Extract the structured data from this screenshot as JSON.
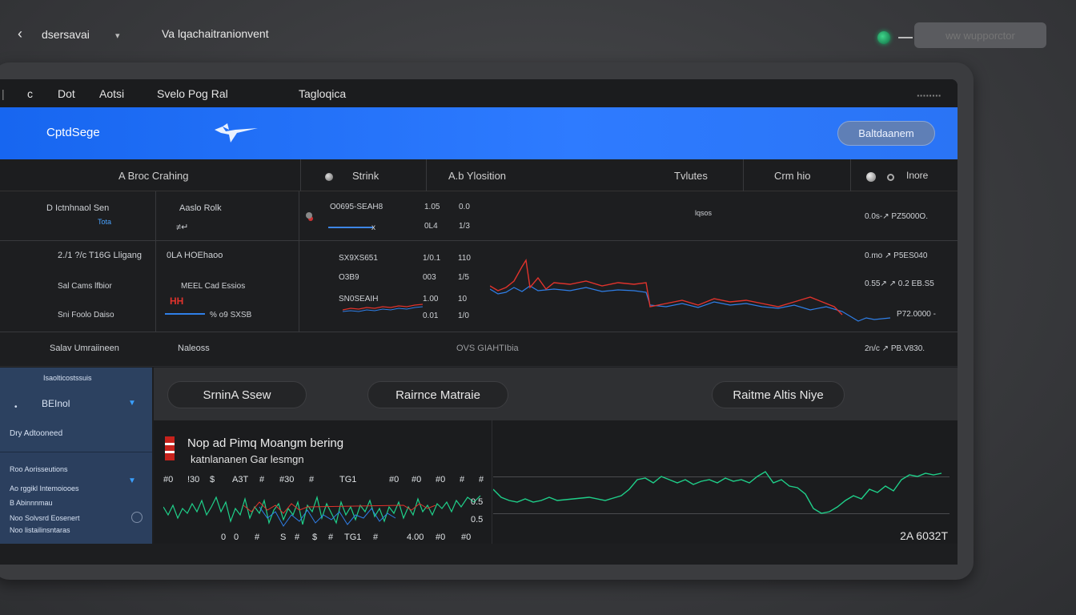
{
  "topbar": {
    "user": "dsersavai",
    "title": "Va lqachaitranionvent",
    "search_placeholder": "ww wupporctor"
  },
  "menu": [
    "Dot",
    "Aotsi",
    "Svelo  Pog  Ral",
    "Tagloqica"
  ],
  "menu_c": "c",
  "menu_dots": "▪▪▪▪▪▪▪▪",
  "header": {
    "brand": "CptdSege",
    "button": "Baltdaanem"
  },
  "table": {
    "headers": [
      "A Broc Crahing",
      "Strink",
      "A.b Ylosition",
      "Tvlutes",
      "Crm hio",
      "Inore"
    ],
    "row1": {
      "c1": "D  Ictnhnaol Sen",
      "c1_sub": "Tota",
      "c2": "Aaslo  Rolk",
      "c2_sub": "≠↵",
      "c3": "O0695-SEAH8",
      "c3_sub": "x",
      "n1": "1.05",
      "n2": "0L4",
      "v1": "0.0",
      "v2": "1/3",
      "mid": "lqsos",
      "right": "0.0s-↗  PZ5000O."
    },
    "row2": {
      "a1": "2./1  ?/c   T16G  Lligang",
      "a2": "0LA   HOEhaoo",
      "b1": "Sal   Cams lfbior",
      "b2": "MEEL   Cad  Essios",
      "c1": "Sni      Foolo  Daiso",
      "c2_badge": "HH",
      "c2": "%  o9     SXSB",
      "l1": "SX9XS651",
      "l2": "O3B9",
      "l3": "SN0SEAIH",
      "n1": "1/0.1",
      "n2": "003",
      "n3": "1.00",
      "n4": "0.01",
      "v1": "110",
      "v2": "1/5",
      "v3": "10",
      "v4": "1/0",
      "r1": "0.mo  ↗  P5ES040",
      "r2": "0.55↗  ↗  0.2  EB.S5",
      "r3": "P72.0000 -"
    },
    "row3": {
      "a": "Salav   Umraiineen",
      "b": "Naleoss",
      "c": "OVS  GIAHTIbia",
      "r": "2n/c  ↗  PB.V830."
    }
  },
  "sidebar": {
    "top_label": "Isaolticostssuis",
    "field": "BEInol",
    "field_dot": "•",
    "sub": "Dry  Adtooneed",
    "item1": "Roo  Aorisseutions",
    "item2": "Ao  rggikl Intemoiooes",
    "item3": "B  Abinnnmau",
    "item4": "Noo  Solvsrd Eosenert",
    "item5": "Noo  listailinsntaras"
  },
  "tabs": [
    "SrninA Ssew",
    "Rairnce Matraie",
    "Raitme Altis Niye"
  ],
  "bottom_chart": {
    "title": "Nop ad Pimq Moangm bering",
    "subtitle": "katnlananen Gar lesmgn",
    "value": "2A  6032T",
    "labels_top": [
      "#0",
      "!30",
      "$",
      "A3T",
      "#",
      "#30",
      "#",
      "TG1",
      "#0",
      "#0",
      "#0",
      "#",
      "#"
    ],
    "labels_bottom": [
      "0",
      "0",
      "#",
      "S",
      "#",
      "$",
      "#",
      "TG1",
      "#",
      "4.00",
      "#0",
      "#0"
    ],
    "side_labels": [
      "0.5",
      "0.5"
    ]
  },
  "colors": {
    "blue_header": "#1766f0",
    "red_line": "#e0332c",
    "blue_line": "#2f7fe8",
    "green_line": "#1fd08a",
    "sidebar": "#2c4160"
  }
}
